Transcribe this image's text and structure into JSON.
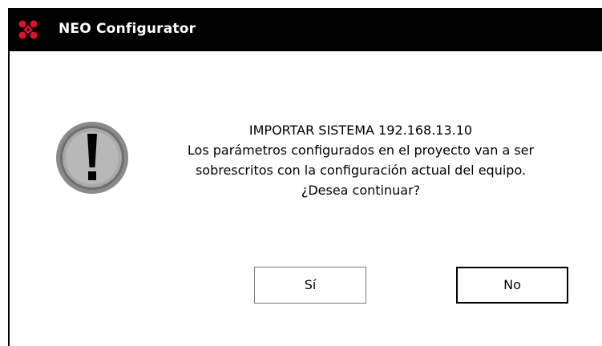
{
  "window": {
    "title": "NEO Configurator"
  },
  "dialog": {
    "message_lines": [
      "IMPORTAR SISTEMA 192.168.13.10",
      "Los parámetros configurados en el proyecto van a ser",
      "sobrescritos con la configuración actual del equipo.",
      "¿Desea continuar?"
    ],
    "icon": "exclamation-warning-icon",
    "buttons": {
      "yes_label": "Sí",
      "no_label": "No"
    }
  },
  "colors": {
    "titlebar_bg": "#000000",
    "title_text": "#ffffff",
    "logo_red": "#e0102a",
    "icon_gray": "#8c8c8c"
  }
}
